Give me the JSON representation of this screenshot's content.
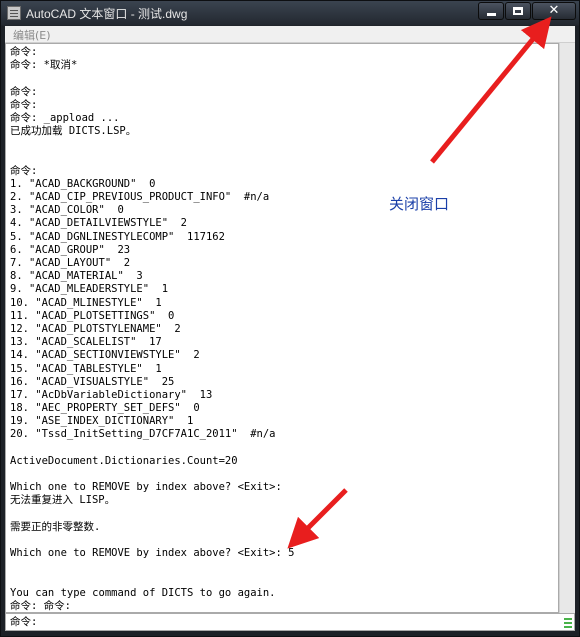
{
  "window": {
    "title": "AutoCAD 文本窗口 - 测试.dwg",
    "controls": {
      "minimize": "",
      "maximize": "",
      "close": "✕"
    }
  },
  "menubar": {
    "items": [
      {
        "label": "编辑(E)"
      }
    ]
  },
  "console": {
    "lines": [
      "命令:",
      "命令: *取消*",
      "",
      "命令:",
      "命令:",
      "命令: _appload ...",
      "已成功加载 DICTS.LSP。",
      "",
      "",
      "命令:",
      "1. \"ACAD_BACKGROUND\"  0",
      "2. \"ACAD_CIP_PREVIOUS_PRODUCT_INFO\"  #n/a",
      "3. \"ACAD_COLOR\"  0",
      "4. \"ACAD_DETAILVIEWSTYLE\"  2",
      "5. \"ACAD_DGNLINESTYLECOMP\"  117162",
      "6. \"ACAD_GROUP\"  23",
      "7. \"ACAD_LAYOUT\"  2",
      "8. \"ACAD_MATERIAL\"  3",
      "9. \"ACAD_MLEADERSTYLE\"  1",
      "10. \"ACAD_MLINESTYLE\"  1",
      "11. \"ACAD_PLOTSETTINGS\"  0",
      "12. \"ACAD_PLOTSTYLENAME\"  2",
      "13. \"ACAD_SCALELIST\"  17",
      "14. \"ACAD_SECTIONVIEWSTYLE\"  2",
      "15. \"ACAD_TABLESTYLE\"  1",
      "16. \"ACAD_VISUALSTYLE\"  25",
      "17. \"AcDbVariableDictionary\"  13",
      "18. \"AEC_PROPERTY_SET_DEFS\"  0",
      "19. \"ASE_INDEX_DICTIONARY\"  1",
      "20. \"Tssd_InitSetting_D7CF7A1C_2011\"  #n/a",
      "",
      "ActiveDocument.Dictionaries.Count=20",
      "",
      "Which one to REMOVE by index above? <Exit>:",
      "无法重复进入 LISP。",
      "",
      "需要正的非零整数.",
      "",
      "Which one to REMOVE by index above? <Exit>: 5",
      "",
      "",
      "You can type command of DICTS to go again.",
      "命令: 命令:"
    ]
  },
  "command_line": {
    "prompt": "命令:"
  },
  "annotation": {
    "text": "关闭窗口"
  },
  "colors": {
    "arrow": "#e81e1e",
    "annotation_text": "#1a3fa8"
  }
}
